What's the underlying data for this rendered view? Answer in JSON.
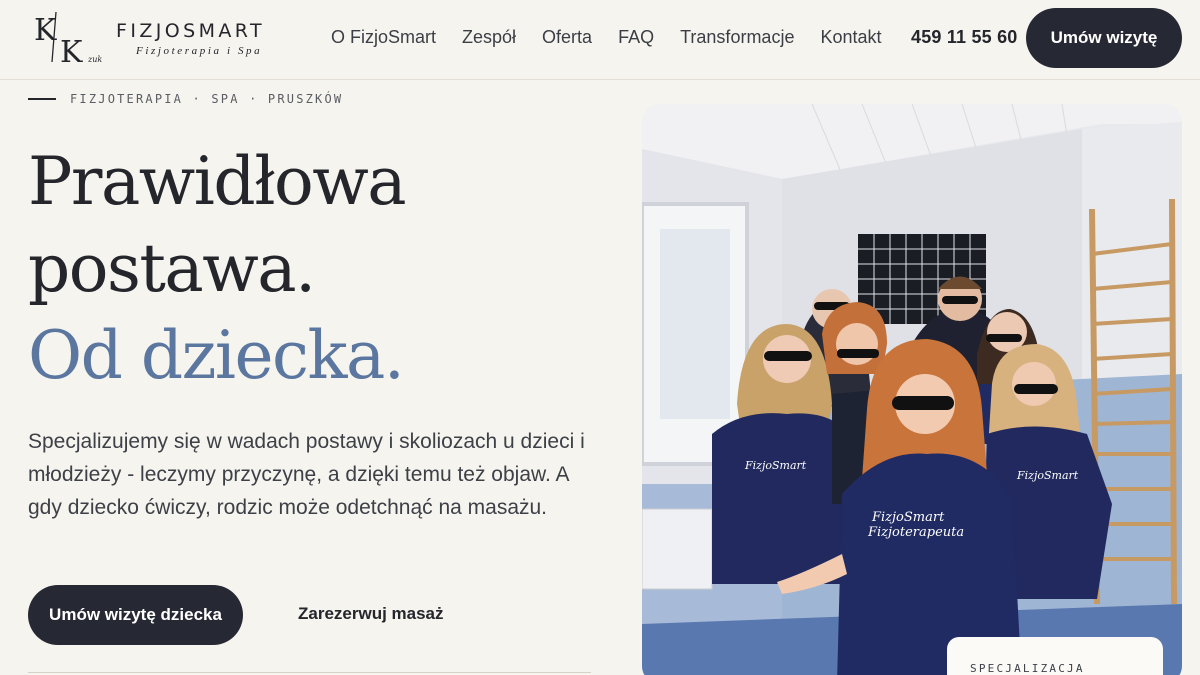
{
  "header": {
    "logo_monogram": "K/K",
    "logo_small": "zuk",
    "brand_name": "FIZJOSMART",
    "brand_tagline": "Fizjoterapia i Spa",
    "nav": [
      {
        "label": "O FizjoSmart"
      },
      {
        "label": "Zespół"
      },
      {
        "label": "Oferta"
      },
      {
        "label": "FAQ"
      },
      {
        "label": "Transformacje"
      },
      {
        "label": "Kontakt"
      }
    ],
    "phone": "459 11 55 60",
    "cta": "Umów wizytę"
  },
  "hero": {
    "eyebrow": "FIZJOTERAPIA · SPA · PRUSZKÓW",
    "title_line1": "Prawidłowa",
    "title_line2": "postawa.",
    "title_accent": "Od dziecka.",
    "description": "Specjalizujemy się w wadach postawy i skoliozach u dzieci i młodzieży - leczymy przyczynę, a dzięki temu też objaw. A gdy dziecko ćwiczy, rodzic może odetchnąć na masażu.",
    "primary_cta": "Umów wizytę dziecka",
    "secondary_cta": "Zarezerwuj masaż"
  },
  "photo": {
    "shirt_text_line1": "FizjoSmart",
    "shirt_text_line2": "Fizjoterapeuta"
  },
  "spec_card": {
    "label": "SPECJALIZACJA"
  },
  "colors": {
    "background": "#f6f4ef",
    "dark": "#262833",
    "accent": "#5b77a0"
  }
}
